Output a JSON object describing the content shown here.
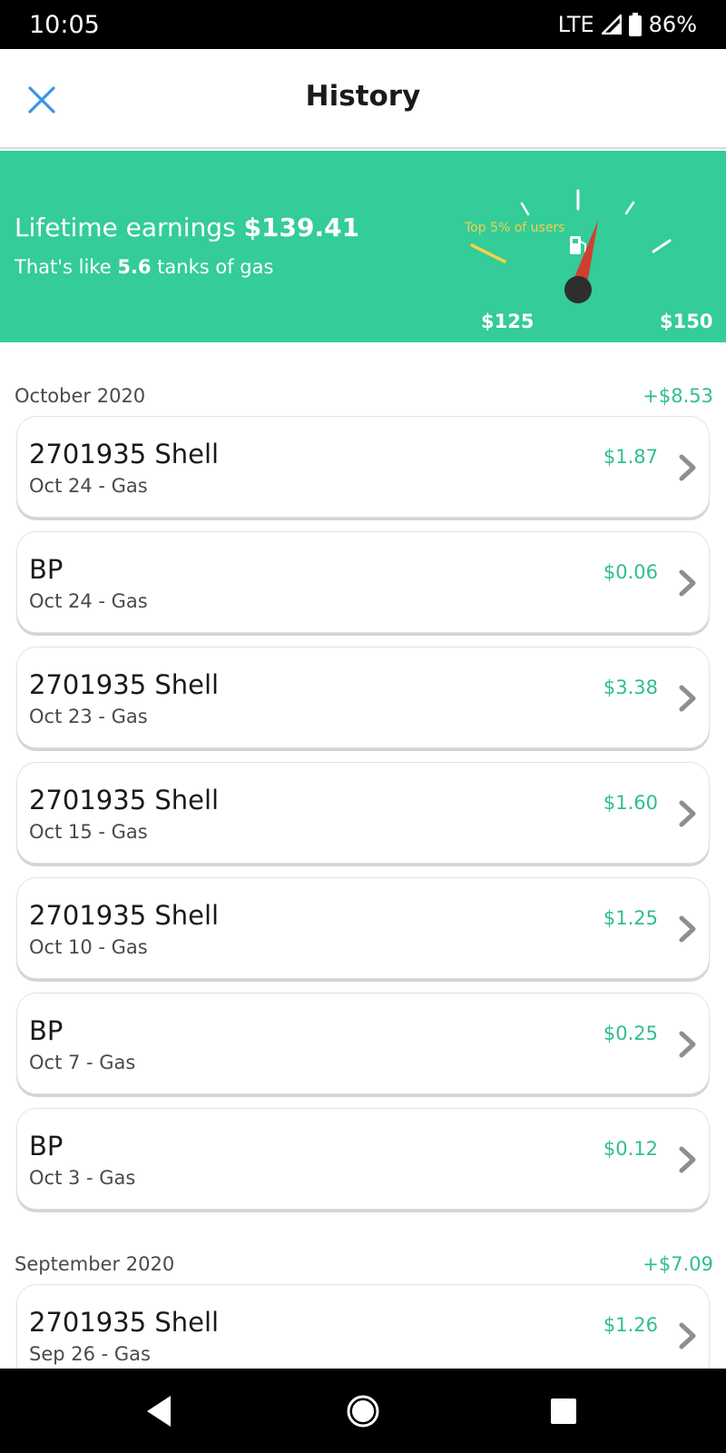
{
  "status_bar": {
    "time": "10:05",
    "network": "LTE",
    "battery": "86%"
  },
  "header": {
    "title": "History",
    "close_icon": "close-icon"
  },
  "banner": {
    "lifetime_label": "Lifetime earnings ",
    "lifetime_value": "$139.41",
    "tanks_prefix": "That's like ",
    "tanks_value": "5.6",
    "tanks_suffix": " tanks of gas",
    "gauge": {
      "top_label": "Top 5% of users",
      "low_label": "$125",
      "high_label": "$150",
      "level": 0.57,
      "icon": "fuel-pump-icon"
    },
    "colors": {
      "background": "#34cc98",
      "needle": "#d0402f",
      "highlight": "#f2d14a"
    }
  },
  "sections": [
    {
      "title": "October 2020",
      "total": "+$8.53",
      "items": [
        {
          "name": "2701935 Shell",
          "detail": "Oct 24 - Gas",
          "amount": "$1.87"
        },
        {
          "name": "BP",
          "detail": "Oct 24 - Gas",
          "amount": "$0.06"
        },
        {
          "name": "2701935 Shell",
          "detail": "Oct 23 - Gas",
          "amount": "$3.38"
        },
        {
          "name": "2701935 Shell",
          "detail": "Oct 15 - Gas",
          "amount": "$1.60"
        },
        {
          "name": "2701935 Shell",
          "detail": "Oct 10 - Gas",
          "amount": "$1.25"
        },
        {
          "name": "BP",
          "detail": "Oct 7 - Gas",
          "amount": "$0.25"
        },
        {
          "name": "BP",
          "detail": "Oct 3 - Gas",
          "amount": "$0.12"
        }
      ]
    },
    {
      "title": "September 2020",
      "total": "+$7.09",
      "items": [
        {
          "name": "2701935 Shell",
          "detail": "Sep 26 - Gas",
          "amount": "$1.26"
        }
      ]
    }
  ],
  "nav": {
    "back_icon": "back-triangle-icon",
    "home_icon": "home-circle-icon",
    "recents_icon": "recents-square-icon"
  }
}
